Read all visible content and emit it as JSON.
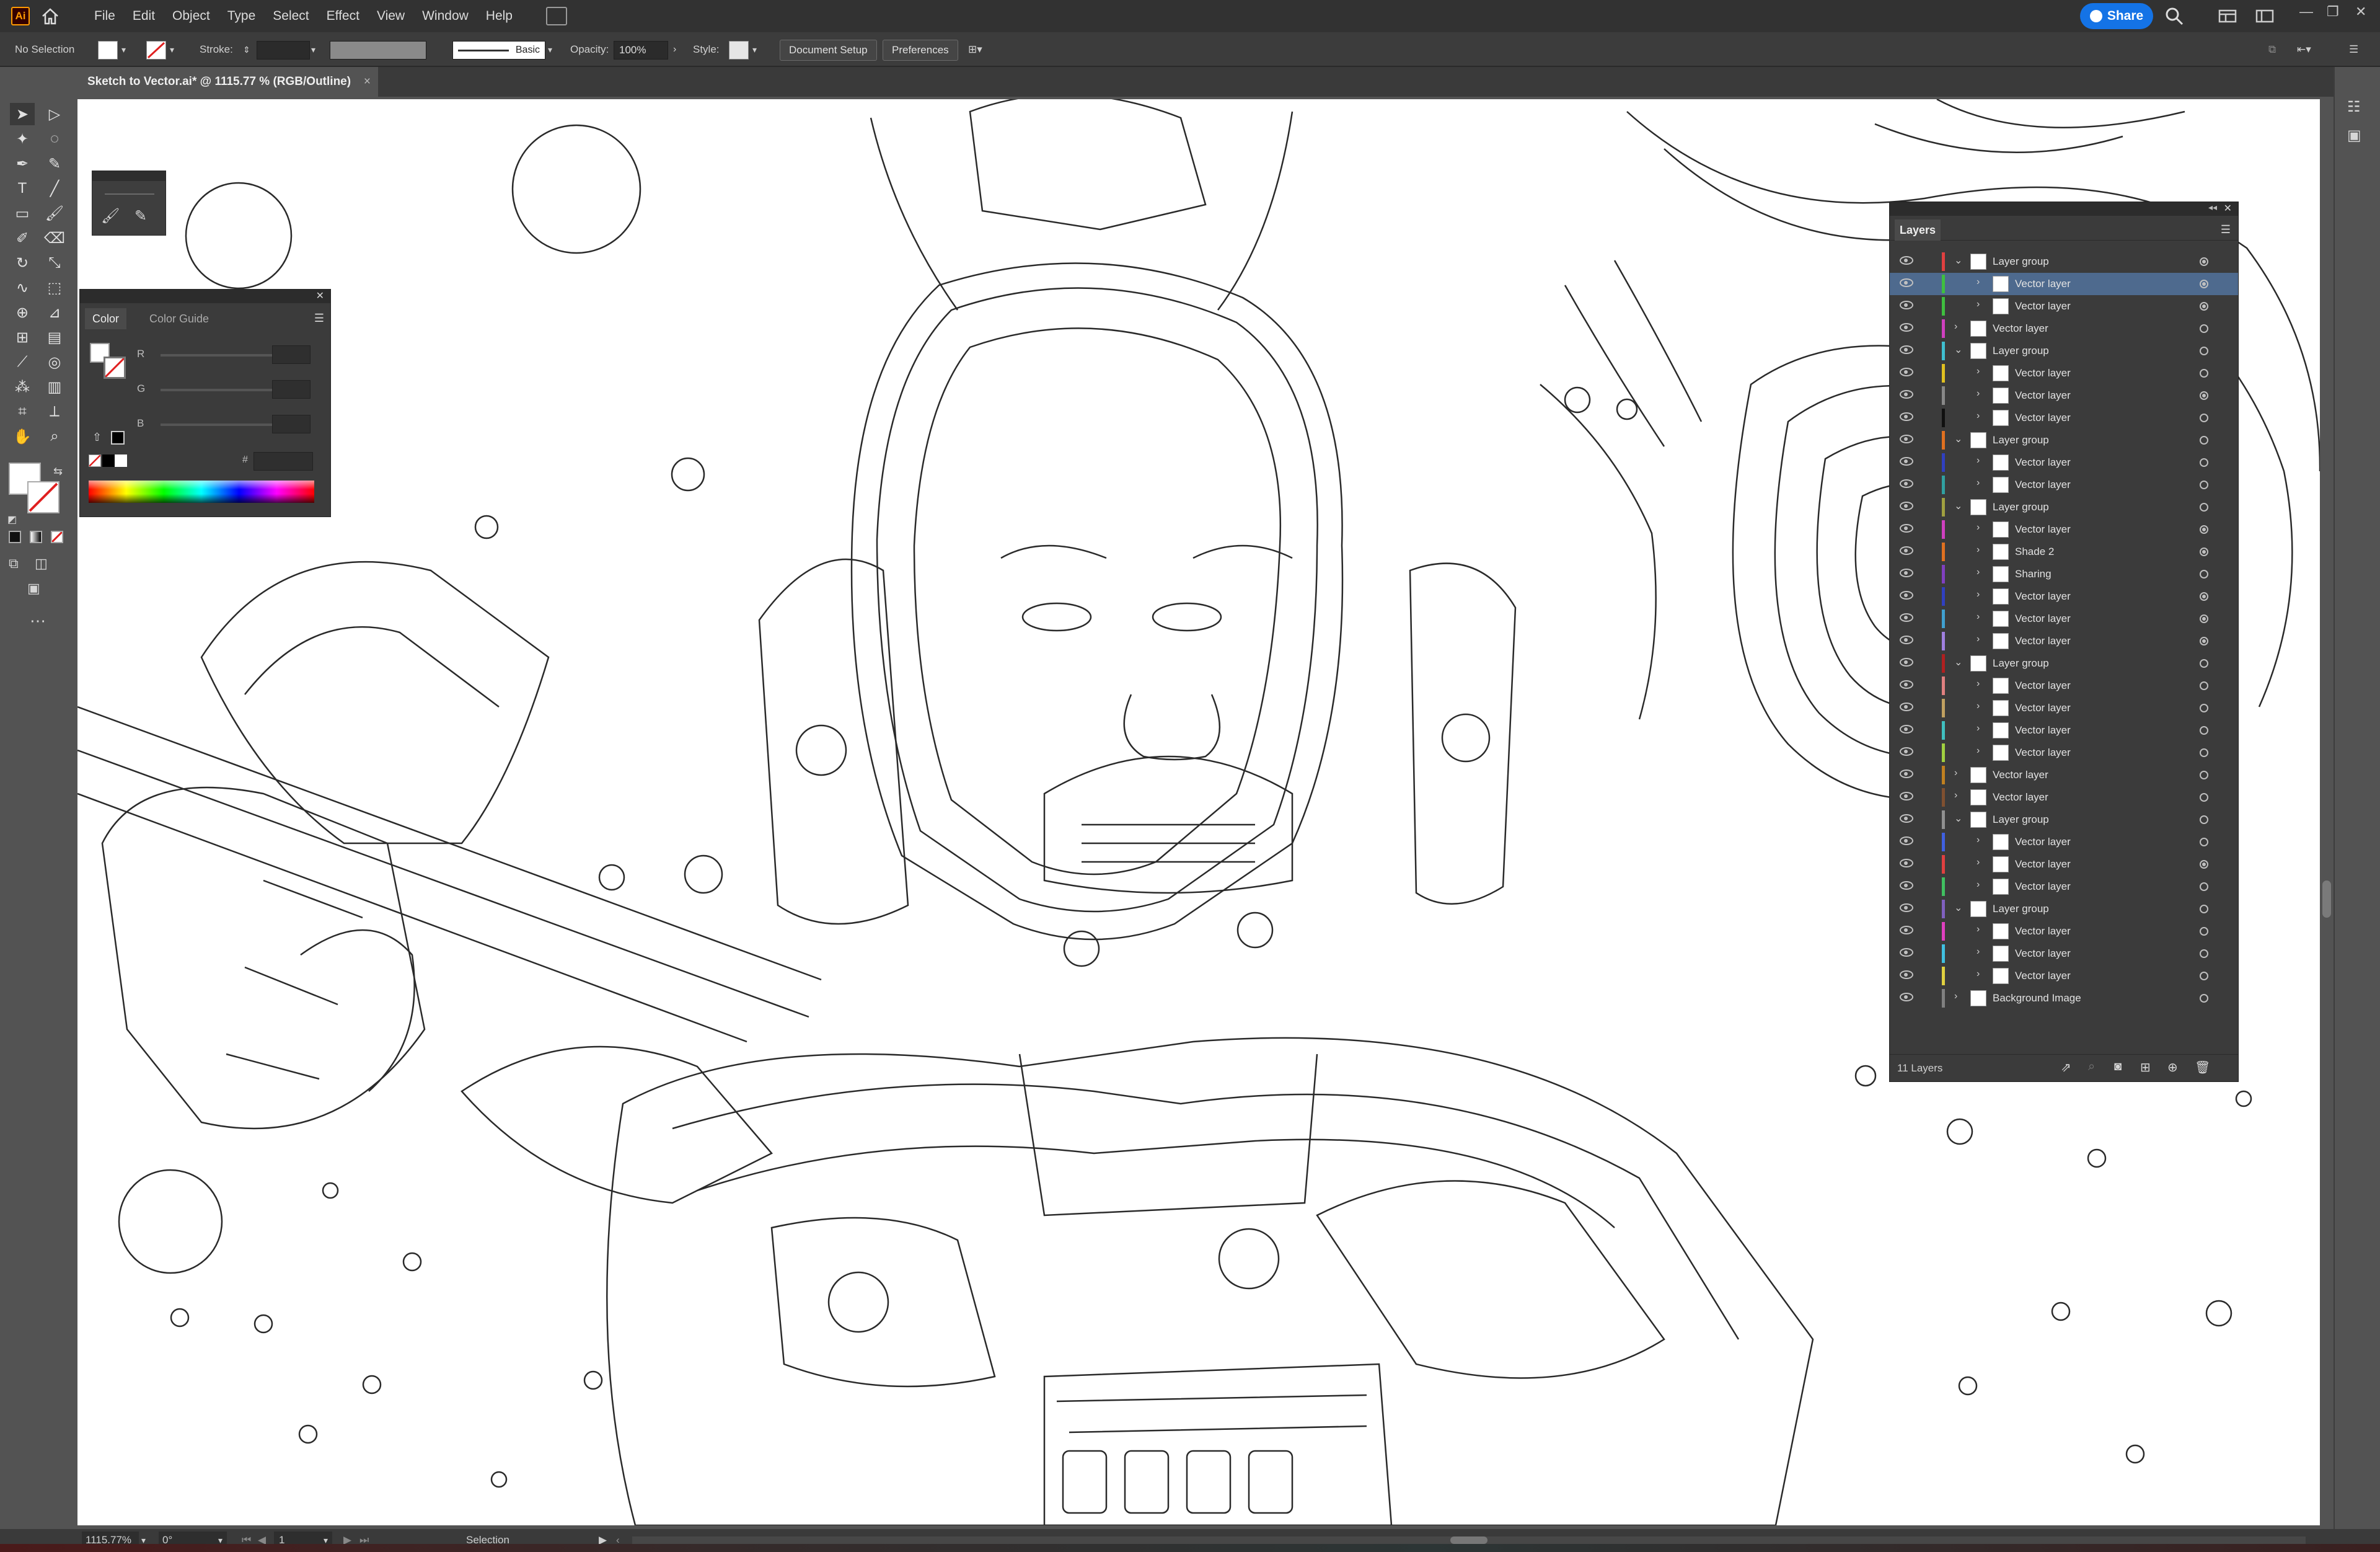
{
  "app": {
    "logo": "Ai"
  },
  "menu": [
    "File",
    "Edit",
    "Object",
    "Type",
    "Select",
    "Effect",
    "View",
    "Window",
    "Help"
  ],
  "share_label": "Share",
  "control": {
    "selection": "No Selection",
    "stroke_label": "Stroke:",
    "brush_label": "Basic",
    "opacity_label": "Opacity:",
    "opacity_value": "100%",
    "style_label": "Style:",
    "document_setup": "Document Setup",
    "preferences": "Preferences"
  },
  "document_tab": {
    "title": "Sketch to Vector.ai* @ 1115.77 % (RGB/Outline)",
    "close": "×"
  },
  "color_panel": {
    "tabs": [
      "Color",
      "Color Guide"
    ],
    "channels": [
      "R",
      "G",
      "B"
    ],
    "hex_label": "#"
  },
  "layers_panel": {
    "title": "Layers",
    "count": "11 Layers",
    "rows": [
      {
        "name": "Layer group",
        "level": 0,
        "expanded": true,
        "color": "#e04040",
        "target": true
      },
      {
        "name": "Vector layer",
        "level": 1,
        "expanded": false,
        "color": "#3fbf3f",
        "target": true,
        "selected": true
      },
      {
        "name": "Vector layer",
        "level": 1,
        "expanded": false,
        "color": "#3fbf3f",
        "target": true
      },
      {
        "name": "Vector layer",
        "level": 0,
        "expanded": false,
        "color": "#d040c0",
        "target": false
      },
      {
        "name": "Layer group",
        "level": 0,
        "expanded": true,
        "color": "#3fbfd0",
        "target": false
      },
      {
        "name": "Vector layer",
        "level": 1,
        "expanded": false,
        "color": "#e0c020",
        "target": false
      },
      {
        "name": "Vector layer",
        "level": 1,
        "expanded": false,
        "color": "#888888",
        "target": true
      },
      {
        "name": "Vector layer",
        "level": 1,
        "expanded": false,
        "color": "#101010",
        "target": false
      },
      {
        "name": "Layer group",
        "level": 0,
        "expanded": true,
        "color": "#e07020",
        "target": false
      },
      {
        "name": "Vector layer",
        "level": 1,
        "expanded": false,
        "color": "#3040c0",
        "target": false
      },
      {
        "name": "Vector layer",
        "level": 1,
        "expanded": false,
        "color": "#30a0a0",
        "target": false
      },
      {
        "name": "Layer group",
        "level": 0,
        "expanded": true,
        "color": "#a0a040",
        "target": false
      },
      {
        "name": "Vector layer",
        "level": 1,
        "expanded": false,
        "color": "#d040c0",
        "target": true
      },
      {
        "name": "Shade 2",
        "level": 1,
        "expanded": false,
        "color": "#e07020",
        "target": true
      },
      {
        "name": "Sharing",
        "level": 1,
        "expanded": false,
        "color": "#8040c0",
        "target": false
      },
      {
        "name": "Vector layer",
        "level": 1,
        "expanded": false,
        "color": "#3040c0",
        "target": true
      },
      {
        "name": "Vector layer",
        "level": 1,
        "expanded": false,
        "color": "#40a0d0",
        "target": true
      },
      {
        "name": "Vector layer",
        "level": 1,
        "expanded": false,
        "color": "#a080e0",
        "target": true
      },
      {
        "name": "Layer group",
        "level": 0,
        "expanded": true,
        "color": "#b02020",
        "target": false
      },
      {
        "name": "Vector layer",
        "level": 1,
        "expanded": false,
        "color": "#e08080",
        "target": false
      },
      {
        "name": "Vector layer",
        "level": 1,
        "expanded": false,
        "color": "#c0a060",
        "target": false
      },
      {
        "name": "Vector layer",
        "level": 1,
        "expanded": false,
        "color": "#40c0c0",
        "target": false
      },
      {
        "name": "Vector layer",
        "level": 1,
        "expanded": false,
        "color": "#a0d040",
        "target": false
      },
      {
        "name": "Vector layer",
        "level": 0,
        "expanded": false,
        "color": "#c08020",
        "target": false
      },
      {
        "name": "Vector layer",
        "level": 0,
        "expanded": false,
        "color": "#805030",
        "target": false
      },
      {
        "name": "Layer group",
        "level": 0,
        "expanded": true,
        "color": "#909090",
        "target": false
      },
      {
        "name": "Vector layer",
        "level": 1,
        "expanded": false,
        "color": "#4060e0",
        "target": false
      },
      {
        "name": "Vector layer",
        "level": 1,
        "expanded": false,
        "color": "#e04040",
        "target": true
      },
      {
        "name": "Vector layer",
        "level": 1,
        "expanded": false,
        "color": "#40c060",
        "target": false
      },
      {
        "name": "Layer group",
        "level": 0,
        "expanded": true,
        "color": "#8060c0",
        "target": false
      },
      {
        "name": "Vector layer",
        "level": 1,
        "expanded": false,
        "color": "#e040c0",
        "target": false
      },
      {
        "name": "Vector layer",
        "level": 1,
        "expanded": false,
        "color": "#40c0e0",
        "target": false
      },
      {
        "name": "Vector layer",
        "level": 1,
        "expanded": false,
        "color": "#e0d040",
        "target": false
      },
      {
        "name": "Background Image",
        "level": 0,
        "expanded": false,
        "color": "#808080",
        "target": false
      }
    ]
  },
  "status": {
    "zoom": "1115.77%",
    "rotation": "0°",
    "artboard": "1",
    "tool": "Selection"
  }
}
